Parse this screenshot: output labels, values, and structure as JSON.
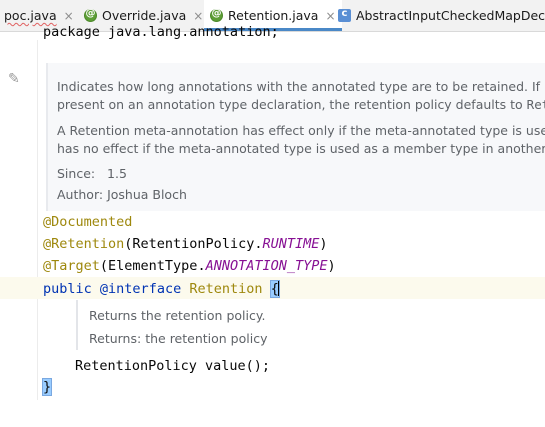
{
  "tabs": [
    {
      "label": "poc.java",
      "icon": "java-file-icon",
      "active": false
    },
    {
      "label": "Override.java",
      "icon": "annotation-icon",
      "active": false
    },
    {
      "label": "Retention.java",
      "icon": "annotation-icon",
      "active": true
    },
    {
      "label": "AbstractInputCheckedMapDecor",
      "icon": "class-icon",
      "active": false
    }
  ],
  "close_glyph": "×",
  "code": {
    "package_line": "package java.lang.annotation;",
    "documented": "@Documented",
    "retention_anno": "@Retention",
    "retention_open": "(RetentionPolicy.",
    "retention_value": "RUNTIME",
    "retention_close": ")",
    "target_anno": "@Target",
    "target_open": "(ElementType.",
    "target_value": "ANNOTATION_TYPE",
    "target_close": ")",
    "public_kw": "public",
    "interface_kw": "@interface",
    "type_name": "Retention",
    "open_brace": "{",
    "method_line": "RetentionPolicy value();",
    "close_brace": "}"
  },
  "doc_comment": {
    "para1_line1": "Indicates how long annotations with the annotated type are to be retained. If no",
    "para1_line2_prefix": "present on an annotation type declaration, the retention policy defaults to ",
    "para1_line2_code": "Reten",
    "para2_line1": "A Retention meta-annotation has effect only if the meta-annotated type is used",
    "para2_line2": "has no effect if the meta-annotated type is used as a member type in another a",
    "since_label": "Since:",
    "since_value": "1.5",
    "author_label": "Author:",
    "author_value": "Joshua Bloch"
  },
  "method_doc": {
    "line1": "Returns the retention policy.",
    "returns_label": "Returns:",
    "returns_value": "the retention policy"
  },
  "colors": {
    "keyword": "#0033b3",
    "annotation": "#9e880d",
    "constant": "#871094",
    "doc_text": "#5f6368",
    "active_tab_underline": "#4a88c7",
    "brace_match": "#99ccff"
  }
}
